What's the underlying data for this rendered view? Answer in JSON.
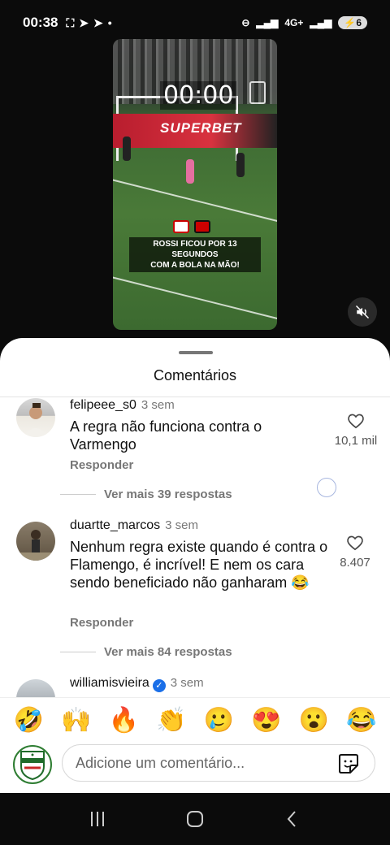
{
  "status": {
    "time": "00:38",
    "network": "4G+",
    "battery": "6"
  },
  "video": {
    "timer": "00:00",
    "banner": "SUPERBET",
    "caption_line1": "ROSSI FICOU POR 13 SEGUNDOS",
    "caption_line2": "COM A BOLA NA MÃO!"
  },
  "comments_panel": {
    "title": "Comentários",
    "comments": [
      {
        "username": "felipeee_s0",
        "time": "3 sem",
        "text": "A regra não funciona contra o Varmengo",
        "likes": "10,1 mil",
        "reply_label": "Responder",
        "more_replies": "Ver mais 39 respostas"
      },
      {
        "username": "duartte_marcos",
        "time": "3 sem",
        "text": "Nenhum regra existe quando é contra o Flamengo, é incrível! E nem os cara sendo beneficiado não ganharam 😂",
        "likes": "8.407",
        "reply_label": "Responder",
        "more_replies": "Ver mais 84 respostas"
      },
      {
        "username": "williamisvieira",
        "time": "3 sem"
      }
    ]
  },
  "composer": {
    "emojis": [
      "🤣",
      "🙌",
      "🔥",
      "👏",
      "🥲",
      "😍",
      "😮",
      "😂"
    ],
    "placeholder": "Adicione um comentário..."
  },
  "colors": {
    "verified": "#1a6fe8",
    "sheet_bg": "#ffffff",
    "bg": "#0b0b0b"
  }
}
